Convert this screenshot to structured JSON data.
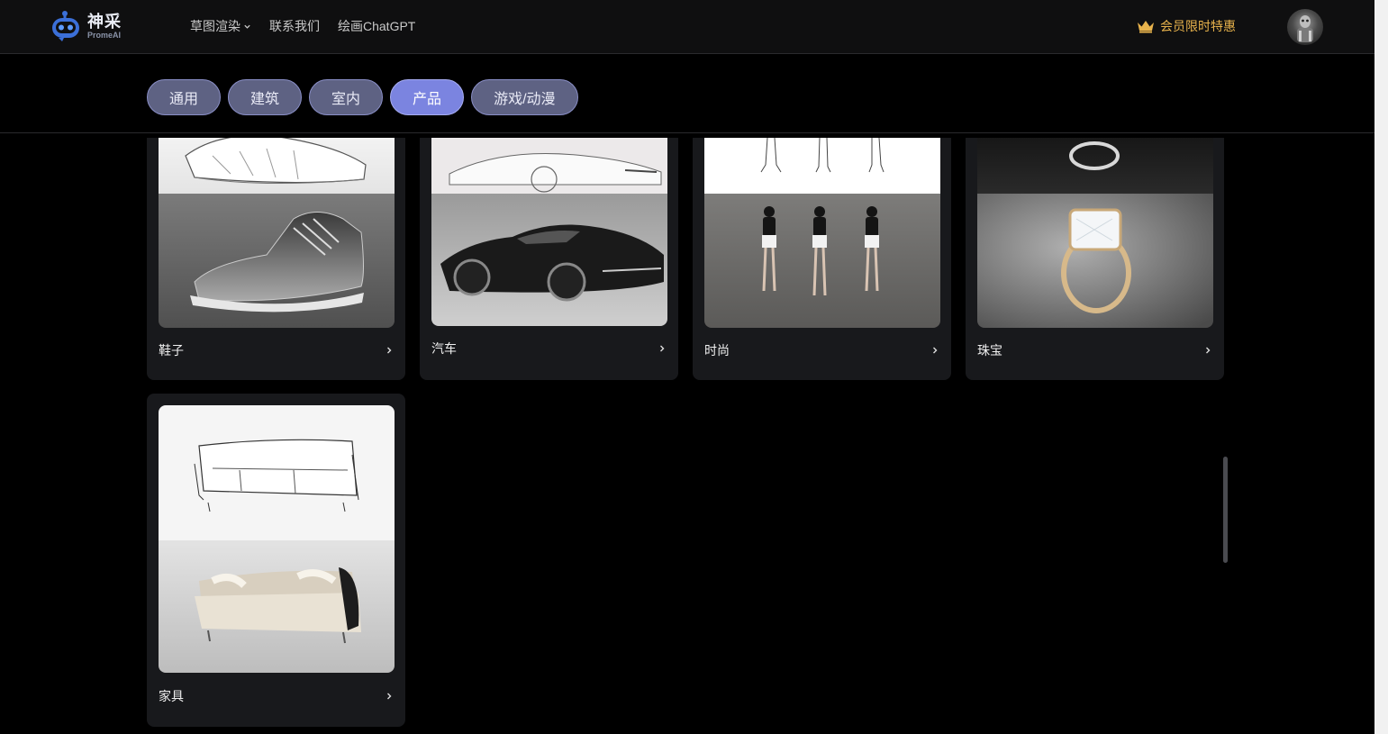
{
  "brand": {
    "name_cn": "神采",
    "name_en": "PromeAI"
  },
  "nav": {
    "items": [
      {
        "label": "草图渲染",
        "has_dropdown": true
      },
      {
        "label": "联系我们"
      },
      {
        "label": "绘画ChatGPT"
      }
    ]
  },
  "vip": {
    "label": "会员限时特惠",
    "icon": "crown-icon",
    "color": "#e8b34c"
  },
  "tabs": [
    {
      "label": "通用",
      "active": false
    },
    {
      "label": "建筑",
      "active": false
    },
    {
      "label": "室内",
      "active": false
    },
    {
      "label": "产品",
      "active": true
    },
    {
      "label": "游戏/动漫",
      "active": false
    }
  ],
  "cards": [
    {
      "title": "鞋子",
      "image": "shoe sketch to render"
    },
    {
      "title": "汽车",
      "image": "car sketch to render"
    },
    {
      "title": "时尚",
      "image": "fashion sketch to render"
    },
    {
      "title": "珠宝",
      "image": "ring sketch to render"
    },
    {
      "title": "家具",
      "image": "sofa sketch to render"
    }
  ],
  "colors": {
    "accent": "#7b84e0",
    "tab": "#5e6283",
    "card_bg": "#18191c"
  }
}
